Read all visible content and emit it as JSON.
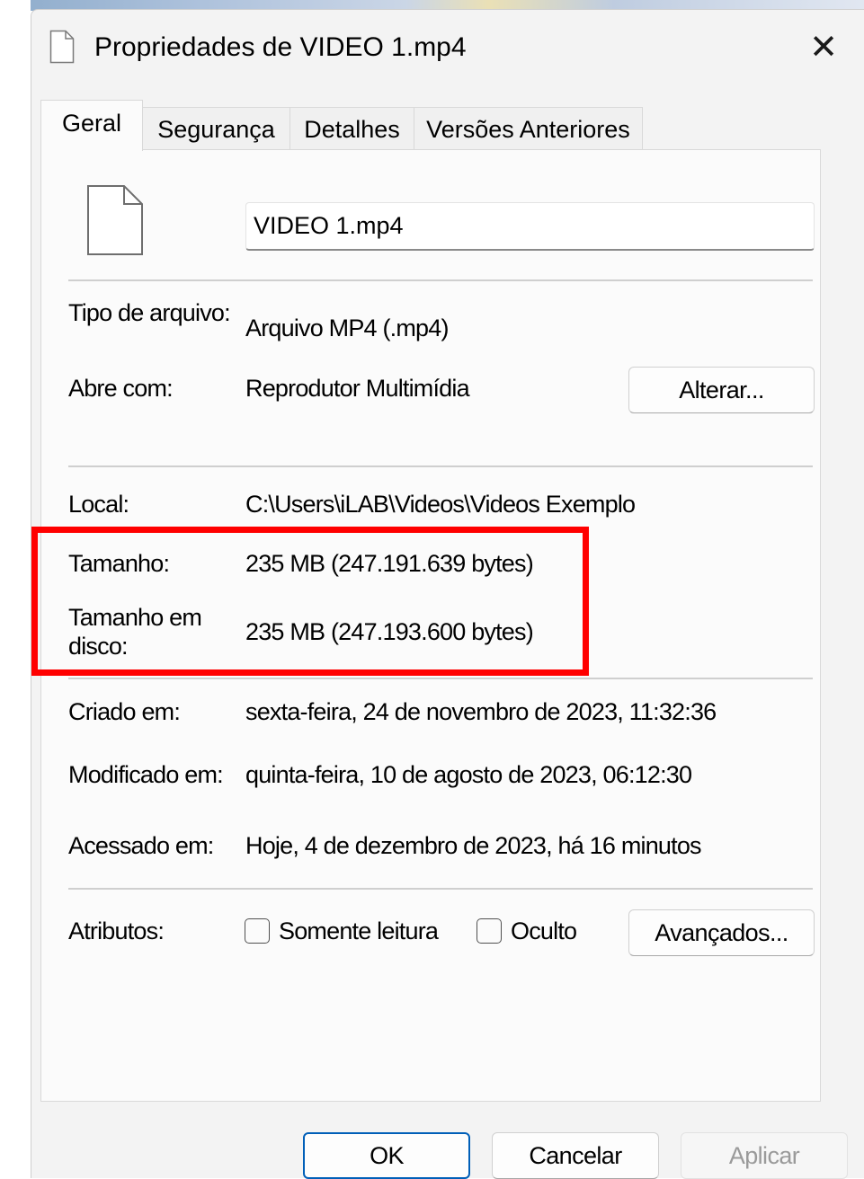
{
  "window": {
    "title": "Propriedades de VIDEO 1.mp4",
    "close_glyph": "✕"
  },
  "tabs": [
    {
      "label": "Geral",
      "active": true
    },
    {
      "label": "Segurança",
      "active": false
    },
    {
      "label": "Detalhes",
      "active": false
    },
    {
      "label": "Versões Anteriores",
      "active": false
    }
  ],
  "general": {
    "file_name": "VIDEO 1.mp4",
    "file_type_label": "Tipo de arquivo:",
    "file_type_value": "Arquivo MP4 (.mp4)",
    "opens_with_label": "Abre com:",
    "opens_with_value": "Reprodutor Multimídia",
    "change_button": "Alterar...",
    "location_label": "Local:",
    "location_value": "C:\\Users\\iLAB\\Videos\\Videos Exemplo",
    "size_label": "Tamanho:",
    "size_value": "235 MB (247.191.639 bytes)",
    "size_on_disk_label": "Tamanho em disco:",
    "size_on_disk_value": "235 MB (247.193.600 bytes)",
    "created_label": "Criado em:",
    "created_value": "sexta-feira, 24 de novembro de 2023, 11:32:36",
    "modified_label": "Modificado em:",
    "modified_value": "quinta-feira, 10 de agosto de 2023, 06:12:30",
    "accessed_label": "Acessado em:",
    "accessed_value": "Hoje, 4 de dezembro de 2023, há 16 minutos",
    "attributes_label": "Atributos:",
    "readonly_label": "Somente leitura",
    "readonly_checked": false,
    "hidden_label": "Oculto",
    "hidden_checked": false,
    "advanced_button": "Avançados..."
  },
  "footer": {
    "ok_label": "OK",
    "cancel_label": "Cancelar",
    "apply_label": "Aplicar"
  },
  "colors": {
    "highlight": "#ff0000",
    "ok_border": "#005fb8",
    "disabled_text": "#9a9a9a"
  },
  "icons": {
    "title_icon": "document-icon",
    "file_icon": "document-icon",
    "close": "close-icon"
  }
}
